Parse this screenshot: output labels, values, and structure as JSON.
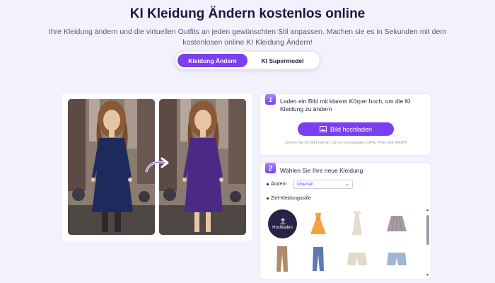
{
  "header": {
    "title": "KI Kleidung Ändern kostenlos online",
    "subtitle": "Ihre Kleidung ändern und die virtuellen Outfits an jeden gewünschten Stil anpassen. Machen sie es in Sekunden mit dem kostenlosen online KI Kleidung Ändern!"
  },
  "tabs": [
    {
      "label": "Kleidung Ändern",
      "active": true
    },
    {
      "label": "KI Supermodel",
      "active": false
    }
  ],
  "step1": {
    "number": "1",
    "text": "Laden ein Bild mit klarem Körper hoch, um die KI Kleidung zu ändern",
    "button_label": "Bild hochladen",
    "hint": "Ziehen Sie Ihr Bild hierhin, um es hochzuladen (JPG, PNG und WEBP)"
  },
  "step2": {
    "number": "2",
    "text": "Wählen Sie Ihre neue Kleidung",
    "change_label": "Ändern",
    "select_value": "Oberteil",
    "styles_label": "Ziel-Kleidungsstile",
    "upload_label": "Hochladen"
  },
  "colors": {
    "accent": "#7b3ff2",
    "dress_before": "#1f2a5c",
    "dress_after": "#4b2a86"
  }
}
